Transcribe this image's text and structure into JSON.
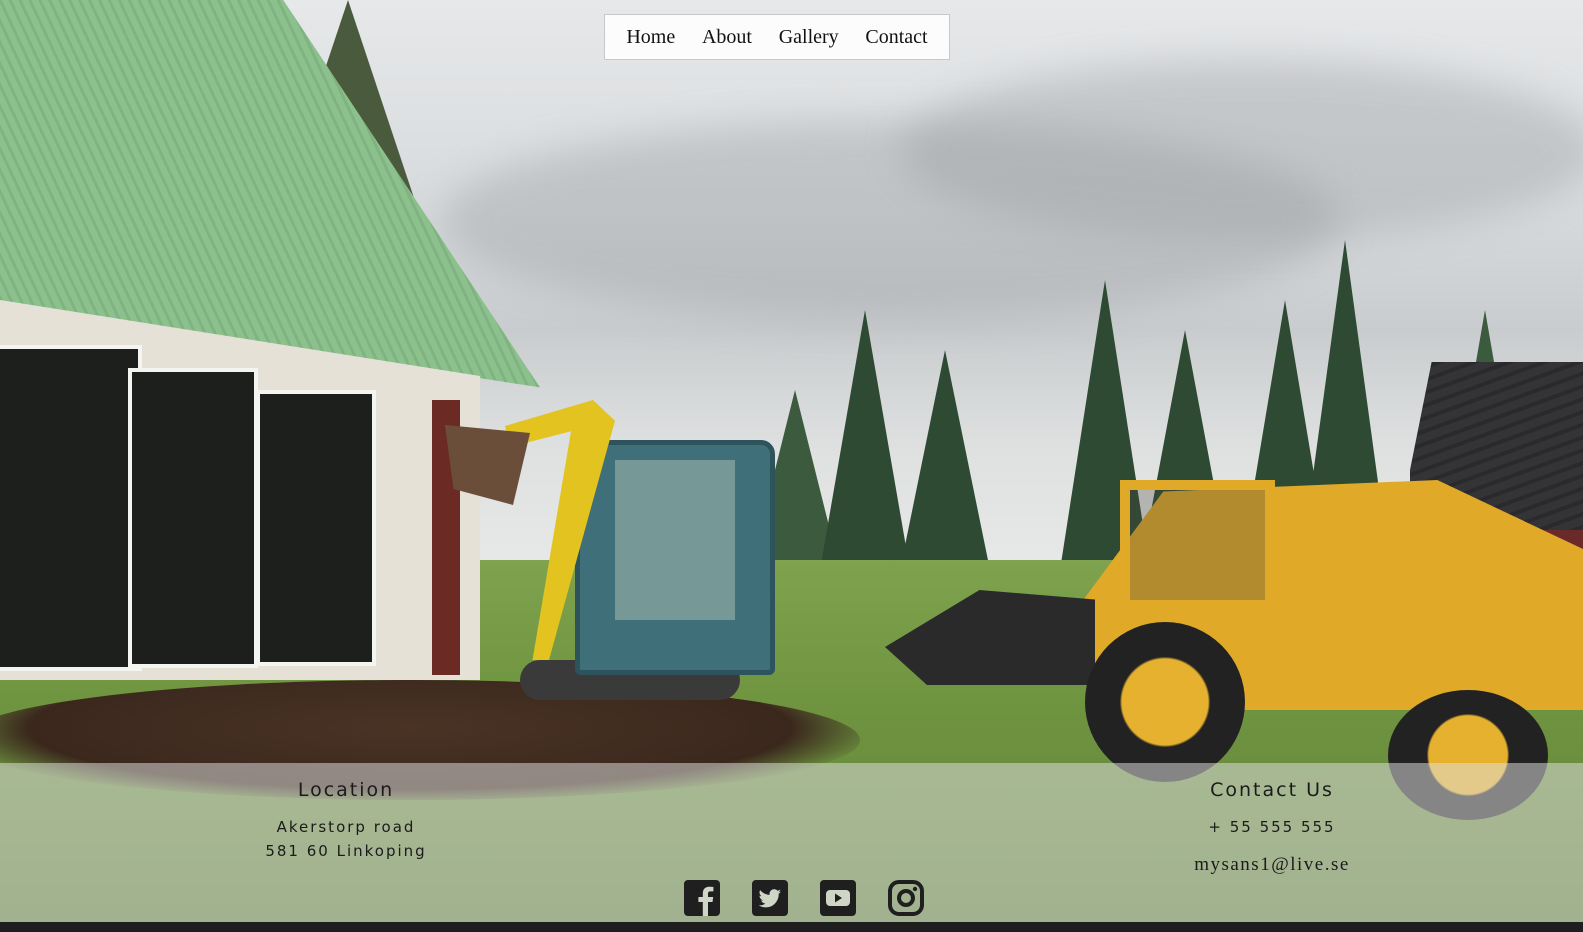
{
  "nav": {
    "items": [
      "Home",
      "About",
      "Gallery",
      "Contact"
    ]
  },
  "footer": {
    "location": {
      "title": "Location",
      "line1": "Akerstorp road",
      "line2": "581 60 Linkoping"
    },
    "contact": {
      "title": "Contact Us",
      "phone": "+ 55 555 555",
      "email": "mysans1@live.se"
    },
    "social_icons": [
      "facebook-icon",
      "twitter-icon",
      "youtube-icon",
      "instagram-icon"
    ]
  },
  "colors": {
    "icon": "#1f1f1f",
    "footer_overlay": "#e1e1e1",
    "nav_border": "#c8c8c8"
  }
}
